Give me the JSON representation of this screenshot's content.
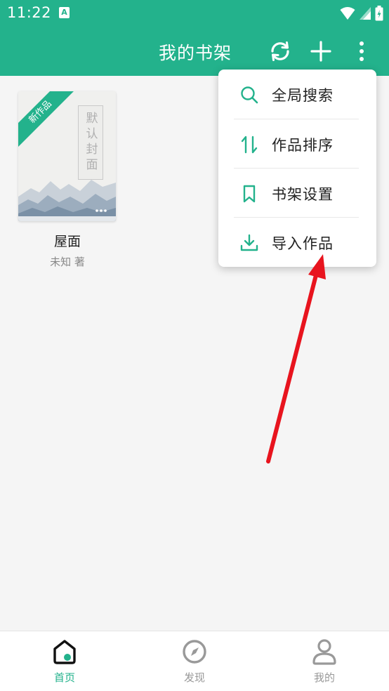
{
  "status_bar": {
    "time": "11:22",
    "badge": "A"
  },
  "app_bar": {
    "title": "我的书架",
    "refresh_icon": "refresh-icon",
    "add_icon": "plus-icon",
    "more_icon": "more-vert-icon"
  },
  "books": [
    {
      "name": "屋面",
      "author": "未知 著",
      "ribbon": "新作品",
      "cover_title": "默认封面"
    }
  ],
  "menu": {
    "items": [
      {
        "label": "全局搜索",
        "icon": "search-icon"
      },
      {
        "label": "作品排序",
        "icon": "sort-icon"
      },
      {
        "label": "书架设置",
        "icon": "bookmark-icon"
      },
      {
        "label": "导入作品",
        "icon": "download-icon"
      }
    ]
  },
  "bottom_nav": {
    "items": [
      {
        "label": "首页",
        "icon": "home-icon",
        "active": true
      },
      {
        "label": "发现",
        "icon": "compass-icon",
        "active": false
      },
      {
        "label": "我的",
        "icon": "person-icon",
        "active": false
      }
    ]
  },
  "colors": {
    "brand": "#23b28c",
    "annotation_arrow": "#e8141e",
    "nav_inactive": "#999999"
  }
}
